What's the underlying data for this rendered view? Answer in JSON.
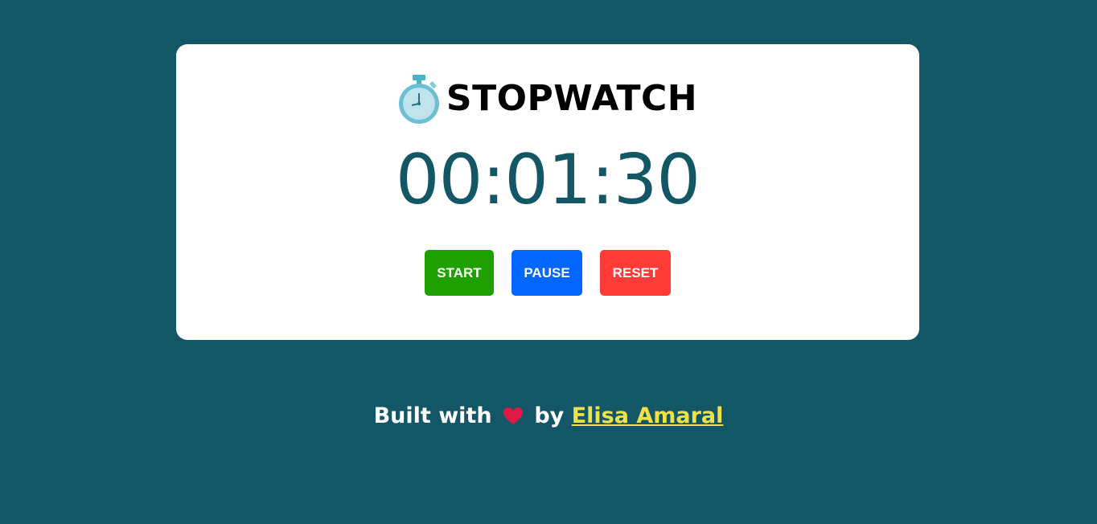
{
  "app": {
    "title": "STOPWATCH",
    "title_icon": "stopwatch-icon"
  },
  "timer": {
    "display": "00:01:30",
    "color": "#135767"
  },
  "controls": {
    "start_label": "START",
    "pause_label": "PAUSE",
    "reset_label": "RESET",
    "start_color": "#1ea000",
    "pause_color": "#0266ff",
    "reset_color": "#ff3b38"
  },
  "footer": {
    "prefix": "Built with",
    "heart_icon": "heart-icon",
    "by": "by",
    "author": "Elisa Amaral",
    "author_color": "#f0e04a"
  },
  "colors": {
    "background": "#135767",
    "card": "#ffffff"
  }
}
